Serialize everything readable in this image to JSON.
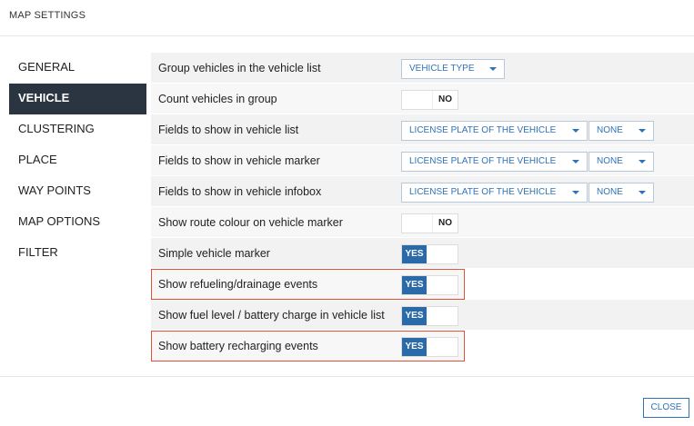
{
  "title": "MAP SETTINGS",
  "sidebar": {
    "items": [
      {
        "label": "GENERAL"
      },
      {
        "label": "VEHICLE"
      },
      {
        "label": "CLUSTERING"
      },
      {
        "label": "PLACE"
      },
      {
        "label": "WAY POINTS"
      },
      {
        "label": "MAP OPTIONS"
      },
      {
        "label": "FILTER"
      }
    ],
    "active": "VEHICLE"
  },
  "settings": {
    "group_vehicles": {
      "label": "Group vehicles in the vehicle list",
      "value": "VEHICLE TYPE"
    },
    "count_vehicles": {
      "label": "Count vehicles in group",
      "value": "NO"
    },
    "fields_list": {
      "label": "Fields to show in vehicle list",
      "value1": "LICENSE PLATE OF THE VEHICLE",
      "value2": "NONE"
    },
    "fields_marker": {
      "label": "Fields to show in vehicle marker",
      "value1": "LICENSE PLATE OF THE VEHICLE",
      "value2": "NONE"
    },
    "fields_infobox": {
      "label": "Fields to show in vehicle infobox",
      "value1": "LICENSE PLATE OF THE VEHICLE",
      "value2": "NONE"
    },
    "route_colour": {
      "label": "Show route colour on vehicle marker",
      "value": "NO"
    },
    "simple_marker": {
      "label": "Simple vehicle marker",
      "value": "YES"
    },
    "refueling_events": {
      "label": "Show refueling/drainage events",
      "value": "YES"
    },
    "fuel_level": {
      "label": "Show fuel level / battery charge in vehicle list",
      "value": "YES"
    },
    "battery_events": {
      "label": "Show battery recharging events",
      "value": "YES"
    }
  },
  "footer": {
    "close_label": "CLOSE"
  },
  "colors": {
    "accent": "#2e73b8",
    "toggle_on": "#2a6aa8",
    "sidebar_active": "#2b3542",
    "highlight": "#e0523a"
  }
}
